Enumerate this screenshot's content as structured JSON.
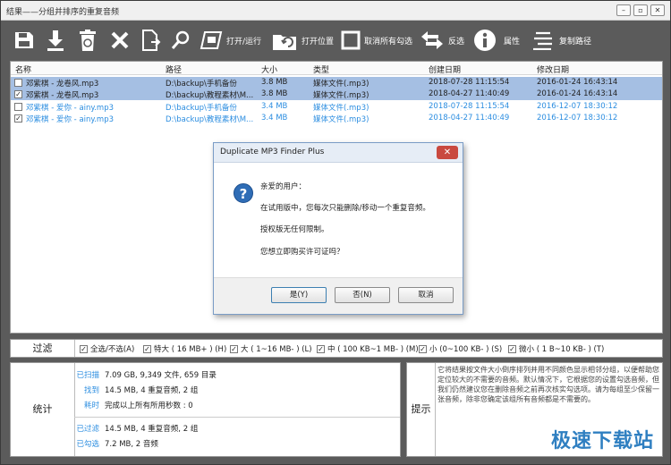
{
  "window": {
    "title": "结果——分组并排序的重复音频"
  },
  "toolbar": {
    "open_run": "打开/运行",
    "open_location": "打开位置",
    "uncheck_all": "取消所有勾选",
    "invert": "反选",
    "properties": "属性",
    "copy_path": "复制路径"
  },
  "table": {
    "columns": [
      "名称",
      "路径",
      "大小",
      "类型",
      "创建日期",
      "修改日期"
    ],
    "rows": [
      {
        "checked": false,
        "name": "邓紫棋 - 龙卷风.mp3",
        "path": "D:\\backup\\手机备份",
        "size": "3.8 MB",
        "type": "媒体文件(.mp3)",
        "created": "2018-07-28 11:15:54",
        "modified": "2016-01-24 16:43:14",
        "check_mark": ""
      },
      {
        "checked": true,
        "name": "邓紫棋 - 龙卷风.mp3",
        "path": "D:\\backup\\教程素材\\M...",
        "size": "3.8 MB",
        "type": "媒体文件(.mp3)",
        "created": "2018-04-27 11:40:49",
        "modified": "2016-01-24 16:43:14",
        "check_mark": "✓"
      },
      {
        "checked": false,
        "name": "邓紫棋 - 爱你 - ainy.mp3",
        "path": "D:\\backup\\手机备份",
        "size": "3.4 MB",
        "type": "媒体文件(.mp3)",
        "created": "2018-07-28 11:15:54",
        "modified": "2016-12-07 18:30:12",
        "check_mark": ""
      },
      {
        "checked": true,
        "name": "邓紫棋 - 爱你 - ainy.mp3",
        "path": "D:\\backup\\教程素材\\M...",
        "size": "3.4 MB",
        "type": "媒体文件(.mp3)",
        "created": "2018-04-27 11:40:49",
        "modified": "2016-12-07 18:30:12",
        "check_mark": "✓"
      }
    ]
  },
  "filter": {
    "label": "过滤",
    "check_mark": "✓",
    "items": [
      "全选/不选(A)",
      "特大 ( 16 MB+ ) (H)",
      "大 ( 1~16 MB- ) (L)",
      "中 ( 100 KB~1 MB- ) (M)",
      "小 (0~100 KB- ) (S)",
      "微小 ( 1 B~10 KB- ) (T)"
    ]
  },
  "stats": {
    "label": "统计",
    "rows": [
      {
        "k": "已扫描",
        "v": "7.09 GB, 9,349 文件, 659 目录"
      },
      {
        "k": "找到",
        "v": "14.5 MB, 4 重复音频, 2 组"
      },
      {
        "k": "耗时",
        "v": "完成以上所有所用秒数 : 0"
      },
      {
        "k": "已过滤",
        "v": "14.5 MB, 4 重复音频, 2 组"
      },
      {
        "k": "已勾选",
        "v": "7.2 MB, 2 音频"
      }
    ]
  },
  "tips": {
    "label": "提示",
    "text": "它将结果按文件大小倒序排列并用不同颜色显示相邻分组，以便帮助您定位较大的不需要的音频。默认情况下，它根据您的设置勾选音频，但我们仍然建议您在删除音频之前再次核实勾选项。请为每组至少保留一张音频，除非您确定该组所有音频都是不需要的。"
  },
  "dialog": {
    "title": "Duplicate MP3 Finder Plus",
    "icon": "?",
    "close": "✕",
    "lines": [
      "亲爱的用户：",
      "在试用版中，您每次只能删除/移动一个重复音频。",
      "授权版无任何限制。",
      "您想立即购买许可证吗？"
    ],
    "yes": "是(Y)",
    "no": "否(N)",
    "cancel": "取消"
  },
  "window_buttons": {
    "minimize": "–",
    "maximize": "▫",
    "close": "✕"
  },
  "watermark": "极速下载站"
}
